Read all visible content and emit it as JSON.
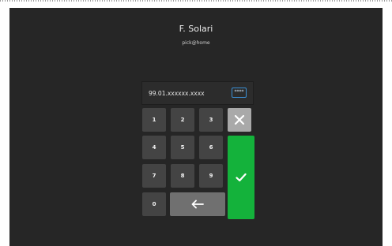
{
  "user": {
    "name": "F. Solari",
    "email": "pick@home"
  },
  "pin": {
    "value": "99.01.xxxxxx.xxxx",
    "mask_toggle_label": "****"
  },
  "keypad": {
    "keys": [
      "1",
      "2",
      "3",
      "4",
      "5",
      "6",
      "7",
      "8",
      "9",
      "0"
    ]
  },
  "icons": {
    "clear": "close-icon",
    "back": "arrow-left-icon",
    "ok": "check-icon"
  },
  "colors": {
    "background": "#262626",
    "key": "#444444",
    "clear_key": "#a9a9a9",
    "back_key": "#707070",
    "ok_key": "#14b23b",
    "focus_border": "#3b8fd4"
  }
}
